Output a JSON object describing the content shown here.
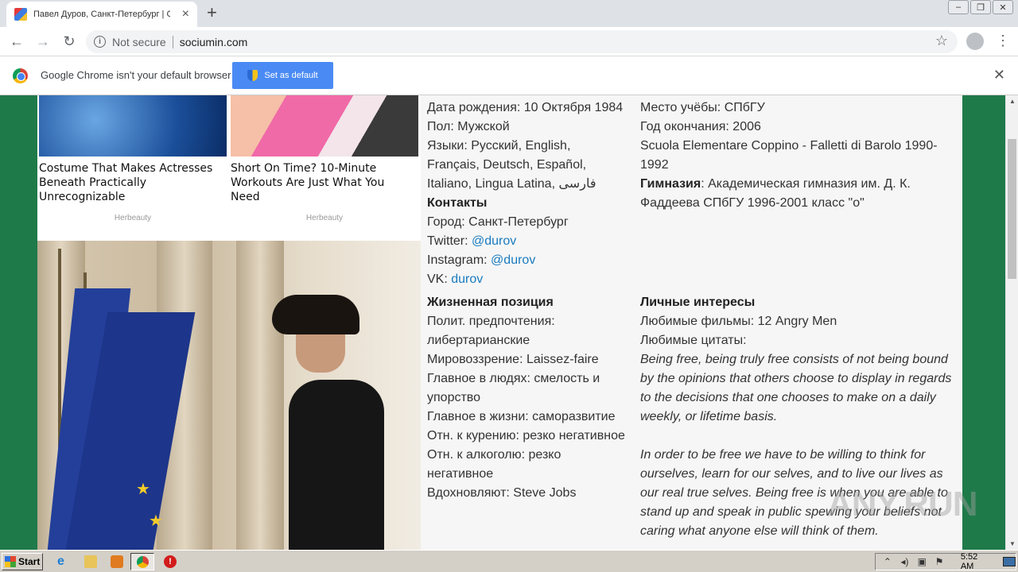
{
  "tab": {
    "title": "Павел Дуров, Санкт-Петербург | С"
  },
  "toolbar": {
    "security_label": "Not secure",
    "url": "sociumin.com"
  },
  "infobar": {
    "message": "Google Chrome isn't your default browser",
    "button_label": "Set as default"
  },
  "ads": [
    {
      "title": "Costume That Makes Actresses Beneath Practically Unrecognizable",
      "source": "Herbeauty"
    },
    {
      "title": "Short On Time? 10-Minute Workouts Are Just What You Need",
      "source": "Herbeauty"
    }
  ],
  "profile": {
    "personal": [
      "Дата рождения: 10 Октября 1984",
      "Пол: Мужской",
      "Языки: Русский, English, Français, Deutsch, Español, Italiano, Lingua Latina, فارسی"
    ],
    "contacts": {
      "heading": "Контакты",
      "city": "Город: Санкт-Петербург",
      "twitter_label": "Twitter:",
      "twitter_value": "@durov",
      "instagram_label": "Instagram:",
      "instagram_value": "@durov",
      "vk_label": "VK:",
      "vk_value": "durov"
    },
    "education": [
      "Место учёбы: СПбГУ",
      "Год окончания: 2006",
      "Scuola Elementare Coppino - Falletti di Barolo 1990-1992"
    ],
    "gymnasium_label": "Гимназия",
    "gymnasium_value": ": Академическая гимназия им. Д. К. Фаддеева СПбГУ 1996-2001 класс \"о\"",
    "life_position": {
      "heading": "Жизненная позиция",
      "rows": [
        "Полит. предпочтения: либертарианские",
        "Мировоззрение: Laissez-faire",
        "Главное в людях: смелость и упорство",
        "Главное в жизни: саморазвитие",
        "Отн. к курению: резко негативное",
        "Отн. к алкоголю: резко негативное",
        "Вдохновляют: Steve Jobs"
      ]
    },
    "interests": {
      "heading": "Личные интересы",
      "films": "Любимые фильмы: 12 Angry Men",
      "quotes_label": "Любимые цитаты:",
      "quote1": "Being free, being truly free consists of not being bound by the opinions that others choose to display in regards to the decisions that one chooses to make on a daily weekly, or lifetime basis.",
      "quote2": "In order to be free we have to be willing to think for ourselves, learn for our selves, and to live our lives as our real true selves. Being free is when you are able to stand up and speak in public spewing your beliefs not caring what anyone else will think of them."
    }
  },
  "watermark": "ANY.RUN",
  "taskbar": {
    "start_label": "Start",
    "clock": "5:52 AM"
  },
  "icons": {
    "back": "back-arrow-icon",
    "forward": "forward-arrow-icon",
    "reload": "reload-icon",
    "bookmark": "star-icon",
    "profile": "profile-icon",
    "menu": "kebab-menu-icon"
  }
}
